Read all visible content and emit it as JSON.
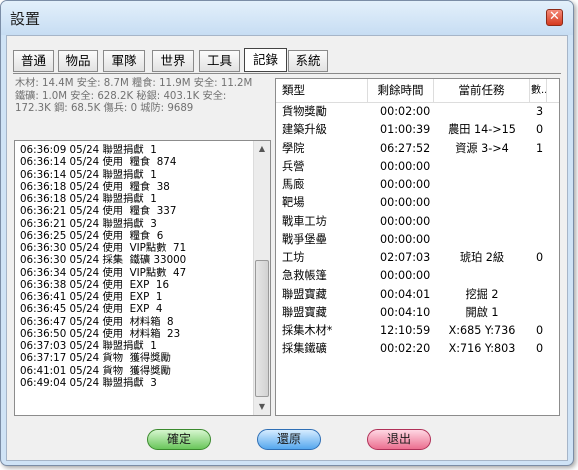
{
  "window": {
    "title": "設置",
    "close_glyph": "✕"
  },
  "tabs": [
    {
      "label": "普通",
      "active": false
    },
    {
      "label": "物品",
      "active": false
    },
    {
      "label": "軍隊",
      "active": false
    },
    {
      "label": "世界",
      "active": false
    },
    {
      "label": "工具",
      "active": false
    },
    {
      "label": "記錄",
      "active": true
    },
    {
      "label": "系統",
      "active": false
    }
  ],
  "resources": {
    "line1": "木材: 14.4M 安全: 8.7M  糧食: 11.9M 安全: 11.2M",
    "line2": "鐵礦: 1.0M 安全: 628.2K  秘銀: 403.1K 安全:",
    "line3": "172.3K  鋼: 68.5K  傷兵: 0  城防: 9689"
  },
  "log": [
    "06:36:09 05/24 聯盟捐獻  1",
    "06:36:14 05/24 使用  糧食  874",
    "06:36:14 05/24 聯盟捐獻  1",
    "06:36:18 05/24 使用  糧食  38",
    "06:36:18 05/24 聯盟捐獻  1",
    "06:36:21 05/24 使用  糧食  337",
    "06:36:21 05/24 聯盟捐獻  3",
    "06:36:25 05/24 使用  糧食  6",
    "06:36:30 05/24 使用  VIP點數  71",
    "06:36:30 05/24 採集  鐵礦 33000",
    "06:36:34 05/24 使用  VIP點數  47",
    "06:36:38 05/24 使用  EXP  16",
    "06:36:41 05/24 使用  EXP  1",
    "06:36:45 05/24 使用  EXP  4",
    "06:36:47 05/24 使用  材料箱  8",
    "06:36:50 05/24 使用  材料箱  23",
    "06:37:03 05/24 聯盟捐獻  1",
    "06:37:17 05/24 貨物  獲得獎勵",
    "06:41:01 05/24 貨物  獲得獎勵",
    "06:49:04 05/24 聯盟捐獻  3"
  ],
  "tasks": {
    "headers": {
      "type": "類型",
      "remaining": "剩餘時間",
      "current": "當前任務",
      "count": "數.."
    },
    "rows": [
      {
        "type": "貨物獎勵",
        "remaining": "00:02:00",
        "current": "",
        "count": "3"
      },
      {
        "type": "建築升級",
        "remaining": "01:00:39",
        "current": "農田 14->15",
        "count": "0"
      },
      {
        "type": "學院",
        "remaining": "06:27:52",
        "current": "資源 3->4",
        "count": "1"
      },
      {
        "type": "兵營",
        "remaining": "00:00:00",
        "current": "",
        "count": ""
      },
      {
        "type": "馬廄",
        "remaining": "00:00:00",
        "current": "",
        "count": ""
      },
      {
        "type": "靶場",
        "remaining": "00:00:00",
        "current": "",
        "count": ""
      },
      {
        "type": "戰車工坊",
        "remaining": "00:00:00",
        "current": "",
        "count": ""
      },
      {
        "type": "戰爭堡壘",
        "remaining": "00:00:00",
        "current": "",
        "count": ""
      },
      {
        "type": "工坊",
        "remaining": "02:07:03",
        "current": "琥珀 2級",
        "count": "0"
      },
      {
        "type": "急救帳篷",
        "remaining": "00:00:00",
        "current": "",
        "count": ""
      },
      {
        "type": "聯盟寶藏",
        "remaining": "00:04:01",
        "current": "挖掘 2",
        "count": ""
      },
      {
        "type": "聯盟寶藏",
        "remaining": "00:04:10",
        "current": "開啟 1",
        "count": ""
      },
      {
        "type": "採集木材*",
        "remaining": "12:10:59",
        "current": "X:685 Y:736",
        "count": "0"
      },
      {
        "type": "採集鐵礦",
        "remaining": "00:02:20",
        "current": "X:716 Y:803",
        "count": "0"
      }
    ]
  },
  "buttons": {
    "confirm": "確定",
    "restore": "還原",
    "exit": "退出"
  }
}
